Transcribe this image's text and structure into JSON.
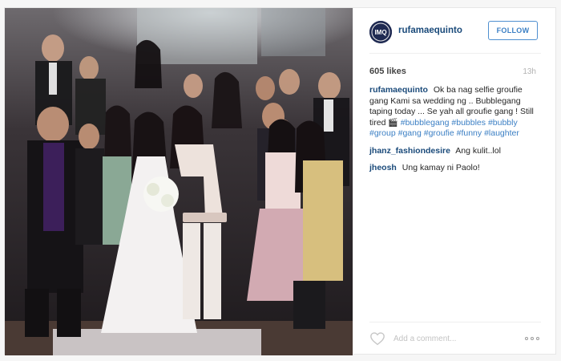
{
  "post": {
    "username": "rufamaequinto",
    "follow_label": "FOLLOW",
    "likes": "605 likes",
    "time": "13h",
    "avatar_initials": "IMQ",
    "caption": {
      "user": "rufamaequinto",
      "text": "Ok ba nag selfie groufie gang Kami sa wedding ng .. Bubblegang taping today ... Se yah all groufie gang ! Still tired",
      "emoji": "🎬",
      "hashtags": [
        "#bubblegang",
        "#bubbles",
        "#bubbly",
        "#group",
        "#gang",
        "#groufie",
        "#funny",
        "#laughter"
      ]
    },
    "comments": [
      {
        "user": "jhanz_fashiondesire",
        "text": "Ang kulit..lol"
      },
      {
        "user": "jheosh",
        "text": "Ung kamay ni Paolo!"
      }
    ],
    "add_comment_placeholder": "Add a comment..."
  },
  "icons": {
    "like": "heart-icon",
    "more": "more-options-icon",
    "avatar": "avatar-logo"
  },
  "colors": {
    "link": "#1a4a7a",
    "hashtag": "#3b7fc4",
    "follow_border": "#4f8fd0"
  }
}
